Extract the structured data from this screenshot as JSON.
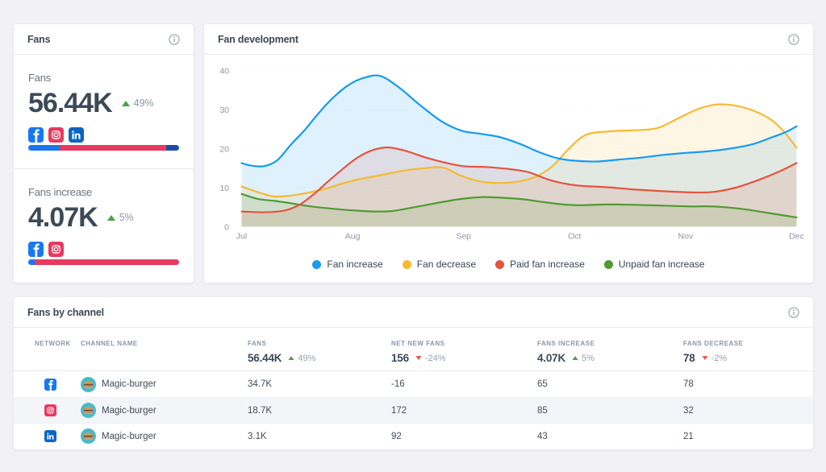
{
  "page": {
    "background": "#f1f1f6",
    "card_background": "#ffffff"
  },
  "colors": {
    "networks": {
      "facebook": "#1877f2",
      "instagram": "#e8395f",
      "linkedin": "#0a66c2"
    },
    "trend_up": "#47a247",
    "trend_down": "#e4574b"
  },
  "fans_card": {
    "title": "Fans",
    "info_icon": "info-circle",
    "sections": [
      {
        "label": "Fans",
        "value": "56.44K",
        "trend": "up",
        "percent": "49%",
        "networks": [
          "facebook",
          "instagram",
          "linkedin"
        ],
        "bar": [
          {
            "network": "facebook",
            "color": "#1877f2",
            "pct": 20.7
          },
          {
            "network": "instagram",
            "color": "#e8395f",
            "pct": 70.6
          },
          {
            "network": "linkedin",
            "color": "#1b4fa4",
            "pct": 8.7
          }
        ]
      },
      {
        "label": "Fans increase",
        "value": "4.07K",
        "trend": "up",
        "percent": "5%",
        "networks": [
          "facebook",
          "instagram"
        ],
        "bar": [
          {
            "network": "facebook",
            "color": "#1877f2",
            "pct": 4.3
          },
          {
            "network": "instagram",
            "color": "#e8395f",
            "pct": 95.7
          }
        ]
      }
    ]
  },
  "chart_card": {
    "title": "Fan development",
    "info_icon": "info-circle"
  },
  "chart_data": {
    "type": "area",
    "title": "Fan development",
    "x_ticks": [
      "Jul",
      "Aug",
      "Sep",
      "Oct",
      "Nov",
      "Dec"
    ],
    "y_ticks": [
      0,
      10,
      20,
      30,
      40
    ],
    "ylim": [
      0,
      40
    ],
    "grid": "dotted-horizontal",
    "legend_position": "bottom",
    "x_unit_months": true,
    "series": [
      {
        "name": "Fan increase",
        "color": "#169bf0",
        "fill_opacity": 0.14,
        "points": [
          [
            0,
            16.3
          ],
          [
            0.08,
            15.7
          ],
          [
            0.2,
            15.5
          ],
          [
            0.32,
            17.0
          ],
          [
            0.45,
            21.2
          ],
          [
            0.56,
            24.5
          ],
          [
            0.66,
            27.9
          ],
          [
            0.76,
            31.2
          ],
          [
            0.87,
            34.2
          ],
          [
            0.97,
            36.4
          ],
          [
            1.1,
            38.1
          ],
          [
            1.25,
            38.6
          ],
          [
            1.42,
            35.6
          ],
          [
            1.6,
            31.3
          ],
          [
            1.8,
            27.0
          ],
          [
            1.98,
            24.6
          ],
          [
            2.15,
            23.8
          ],
          [
            2.32,
            23.0
          ],
          [
            2.5,
            21.3
          ],
          [
            2.68,
            19.1
          ],
          [
            2.85,
            17.5
          ],
          [
            3.0,
            16.9
          ],
          [
            3.2,
            16.7
          ],
          [
            3.4,
            17.2
          ],
          [
            3.6,
            17.7
          ],
          [
            3.8,
            18.4
          ],
          [
            4.0,
            18.9
          ],
          [
            4.2,
            19.3
          ],
          [
            4.4,
            20.0
          ],
          [
            4.6,
            21.1
          ],
          [
            4.78,
            22.9
          ],
          [
            4.9,
            24.2
          ],
          [
            5,
            25.7
          ]
        ]
      },
      {
        "name": "Fan decrease",
        "color": "#f6ba30",
        "fill_opacity": 0.13,
        "points": [
          [
            0,
            10.3
          ],
          [
            0.13,
            9.0
          ],
          [
            0.28,
            7.8
          ],
          [
            0.42,
            7.9
          ],
          [
            0.58,
            8.6
          ],
          [
            0.75,
            9.7
          ],
          [
            0.9,
            11.0
          ],
          [
            1.05,
            12.1
          ],
          [
            1.25,
            13.2
          ],
          [
            1.45,
            14.3
          ],
          [
            1.65,
            15.0
          ],
          [
            1.82,
            15.1
          ],
          [
            1.98,
            13.0
          ],
          [
            2.15,
            11.6
          ],
          [
            2.32,
            11.2
          ],
          [
            2.5,
            11.6
          ],
          [
            2.65,
            12.8
          ],
          [
            2.8,
            15.5
          ],
          [
            2.95,
            20.0
          ],
          [
            3.1,
            23.5
          ],
          [
            3.3,
            24.4
          ],
          [
            3.55,
            24.7
          ],
          [
            3.75,
            25.3
          ],
          [
            3.95,
            28.0
          ],
          [
            4.12,
            30.2
          ],
          [
            4.28,
            31.3
          ],
          [
            4.45,
            31.0
          ],
          [
            4.62,
            29.6
          ],
          [
            4.78,
            27.2
          ],
          [
            4.9,
            23.9
          ],
          [
            5,
            20.2
          ]
        ]
      },
      {
        "name": "Paid fan increase",
        "color": "#e35540",
        "fill_opacity": 0.13,
        "points": [
          [
            0,
            3.9
          ],
          [
            0.2,
            3.7
          ],
          [
            0.38,
            4.1
          ],
          [
            0.52,
            5.6
          ],
          [
            0.65,
            8.3
          ],
          [
            0.78,
            11.6
          ],
          [
            0.92,
            15.0
          ],
          [
            1.05,
            17.8
          ],
          [
            1.18,
            19.6
          ],
          [
            1.32,
            20.3
          ],
          [
            1.48,
            19.4
          ],
          [
            1.65,
            17.8
          ],
          [
            1.82,
            16.5
          ],
          [
            2.0,
            15.5
          ],
          [
            2.2,
            15.3
          ],
          [
            2.4,
            14.8
          ],
          [
            2.58,
            14.0
          ],
          [
            2.75,
            12.2
          ],
          [
            2.9,
            11.1
          ],
          [
            3.05,
            10.5
          ],
          [
            3.3,
            10.1
          ],
          [
            3.55,
            9.5
          ],
          [
            3.8,
            9.1
          ],
          [
            4.05,
            8.8
          ],
          [
            4.25,
            8.9
          ],
          [
            4.45,
            10.0
          ],
          [
            4.65,
            11.9
          ],
          [
            4.85,
            14.2
          ],
          [
            5,
            16.3
          ]
        ]
      },
      {
        "name": "Unpaid fan increase",
        "color": "#529a33",
        "fill_opacity": 0.13,
        "points": [
          [
            0,
            8.4
          ],
          [
            0.15,
            7.1
          ],
          [
            0.3,
            6.6
          ],
          [
            0.45,
            6.0
          ],
          [
            0.6,
            5.3
          ],
          [
            0.75,
            4.8
          ],
          [
            0.9,
            4.4
          ],
          [
            1.05,
            4.1
          ],
          [
            1.2,
            3.9
          ],
          [
            1.35,
            4.0
          ],
          [
            1.5,
            4.7
          ],
          [
            1.65,
            5.5
          ],
          [
            1.82,
            6.4
          ],
          [
            2.0,
            7.2
          ],
          [
            2.18,
            7.6
          ],
          [
            2.36,
            7.4
          ],
          [
            2.55,
            7.0
          ],
          [
            2.72,
            6.3
          ],
          [
            2.9,
            5.7
          ],
          [
            3.05,
            5.5
          ],
          [
            3.3,
            5.7
          ],
          [
            3.55,
            5.6
          ],
          [
            3.8,
            5.4
          ],
          [
            4.05,
            5.2
          ],
          [
            4.25,
            5.2
          ],
          [
            4.5,
            4.6
          ],
          [
            4.75,
            3.5
          ],
          [
            5,
            2.4
          ]
        ]
      }
    ]
  },
  "table_card": {
    "title": "Fans by channel",
    "info_icon": "info-circle",
    "columns": [
      "Network",
      "Channel name",
      "Fans",
      "Net new fans",
      "Fans increase",
      "Fans decrease"
    ],
    "summary": [
      {
        "value": "56.44K",
        "trend": "up",
        "percent": "49%"
      },
      {
        "value": "156",
        "trend": "down",
        "percent": "-24%"
      },
      {
        "value": "4.07K",
        "trend": "up",
        "percent": "5%"
      },
      {
        "value": "78",
        "trend": "down",
        "percent": "-2%"
      }
    ],
    "rows": [
      {
        "network": "facebook",
        "channel": "Magic-burger",
        "fans": "34.7K",
        "net_new_fans": "-16",
        "fans_increase": "65",
        "fans_decrease": "78"
      },
      {
        "network": "instagram",
        "channel": "Magic-burger",
        "fans": "18.7K",
        "net_new_fans": "172",
        "fans_increase": "85",
        "fans_decrease": "32"
      },
      {
        "network": "linkedin",
        "channel": "Magic-burger",
        "fans": "3.1K",
        "net_new_fans": "92",
        "fans_increase": "43",
        "fans_decrease": "21"
      }
    ]
  }
}
